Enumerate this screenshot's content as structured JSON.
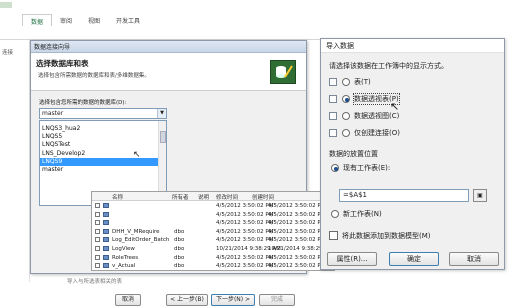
{
  "excel": {
    "tabs": [
      "数据",
      "审阅",
      "视图",
      "开发工具"
    ],
    "left_item": "连接"
  },
  "wizard": {
    "title": "数据连接向导",
    "heading": "选择数据库和表",
    "description": "选择包含所需数据的数据库和表/多维数据集。",
    "db_label": "选择包含您所需的数据的数据库(D):",
    "db_selected": "master",
    "db_list": [
      "LNQS3_hua2",
      "LNQS5",
      "LNQSTest",
      "LNS_Develop2",
      "LNQS9",
      "master"
    ],
    "table_columns": [
      "名称",
      "所有者",
      "说明",
      "修改时间",
      "创建时间"
    ],
    "table_rows": [
      {
        "name": "",
        "owner": "",
        "modified": "4/5/2012 3:50:02 PM",
        "created": "4/5/2012 3:50:02 PM"
      },
      {
        "name": "",
        "owner": "",
        "modified": "4/5/2012 3:50:02 PM",
        "created": "4/5/2012 3:50:02 PM"
      },
      {
        "name": "",
        "owner": "",
        "modified": "4/5/2012 3:50:02 PM",
        "created": "4/5/2012 3:50:02 PM"
      },
      {
        "name": "DHH_V_MRequire",
        "owner": "dbo",
        "modified": "4/5/2012 3:50:02 PM",
        "created": "4/5/2012 3:50:02 PM"
      },
      {
        "name": "Log_EditOrder_Batch",
        "owner": "dbo",
        "modified": "4/5/2012 3:50:02 PM",
        "created": "4/5/2012 3:50:02 PM"
      },
      {
        "name": "LogView",
        "owner": "dbo",
        "modified": "10/21/2014 9:38:29 AM",
        "created": "10/21/2014 9:38:29 AM"
      },
      {
        "name": "RoleTrees",
        "owner": "dbo",
        "modified": "4/5/2012 3:50:02 PM",
        "created": "4/5/2012 3:50:02 PM"
      },
      {
        "name": "v_Actual",
        "owner": "dbo",
        "modified": "4/5/2012 3:50:02 PM",
        "created": "4/5/2012 3:50:02 PM"
      }
    ],
    "bottom_check": "导入与所选表相关的表",
    "buttons": {
      "cancel": "取消",
      "back": "< 上一步(B)",
      "next": "下一步(N) >",
      "finish": "完成"
    }
  },
  "import": {
    "title": "导入数据",
    "prompt": "请选择该数据在工作簿中的显示方式。",
    "options": [
      {
        "label": "表(T)",
        "selected": false
      },
      {
        "label": "数据透视表(P)",
        "selected": true
      },
      {
        "label": "数据透视图(C)",
        "selected": false
      },
      {
        "label": "仅创建连接(O)",
        "selected": false
      }
    ],
    "position_label": "数据的放置位置",
    "existing_sheet": "现有工作表(E):",
    "range_value": "=$A$1",
    "new_sheet": "新工作表(N)",
    "add_model": "将此数据添加到数据模型(M)",
    "buttons": {
      "properties": "属性(R)...",
      "ok": "确定",
      "cancel": "取消"
    }
  }
}
